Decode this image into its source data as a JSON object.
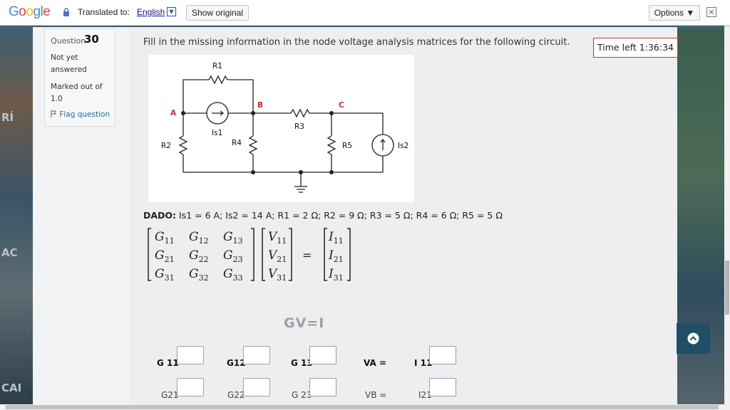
{
  "translate_bar": {
    "logo": [
      "G",
      "o",
      "o",
      "g",
      "l",
      "e"
    ],
    "logo_colors": [
      "#4285F4",
      "#EA4335",
      "#FBBC05",
      "#4285F4",
      "#34A853",
      "#EA4335"
    ],
    "translated_to": "Translated to:",
    "language": "English",
    "show_original": "Show original",
    "options": "Options ▼",
    "close": "×"
  },
  "background": {
    "words": [
      "RÍ",
      "AC",
      "CAI"
    ]
  },
  "question": {
    "label": "Question",
    "number": "30",
    "state": "Not yet answered",
    "marked": "Marked out of 1.0",
    "flag": "Flag question",
    "text": "Fill in the missing information in the node voltage analysis matrices for the following circuit."
  },
  "timer": "Time left 1:36:34",
  "circuit": {
    "labels": {
      "R1": "R1",
      "R2": "R2",
      "R3": "R3",
      "R4": "R4",
      "R5": "R5",
      "Is1": "Is1",
      "Is2": "Is2",
      "A": "A",
      "B": "B",
      "C": "C"
    }
  },
  "dado": {
    "label": "DADO:",
    "values": "Is1 = 6 A; Is2 = 14 A; R1 = 2 Ω; R2 = 9 Ω; R3 = 5 Ω; R4 = 6 Ω; R5 = 5 Ω"
  },
  "matrix": {
    "G": [
      [
        "G",
        "11"
      ],
      [
        "G",
        "12"
      ],
      [
        "G",
        "13"
      ],
      [
        "G",
        "21"
      ],
      [
        "G",
        "22"
      ],
      [
        "G",
        "23"
      ],
      [
        "G",
        "31"
      ],
      [
        "G",
        "32"
      ],
      [
        "G",
        "33"
      ]
    ],
    "V": [
      [
        "V",
        "11"
      ],
      [
        "V",
        "21"
      ],
      [
        "V",
        "31"
      ]
    ],
    "I": [
      [
        "I",
        "11"
      ],
      [
        "I",
        "21"
      ],
      [
        "I",
        "31"
      ]
    ],
    "equals": "="
  },
  "gvi": "GV=I",
  "answer_labels": {
    "g11": "G 11",
    "g12": "G12",
    "g13": "G 13",
    "va": "VA  =",
    "i11": "I 11",
    "g21": "G21",
    "g22": "G22",
    "g23": "G 23",
    "vb": "VB  =",
    "i21": "I21"
  }
}
